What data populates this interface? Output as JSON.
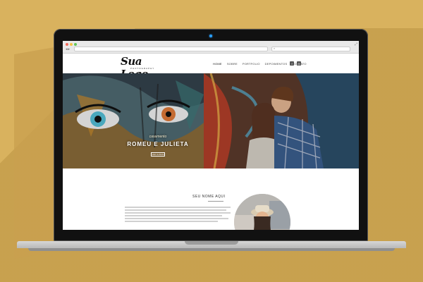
{
  "logo": {
    "main": "Sua Logo",
    "sub": "PHOTOGRAPHY"
  },
  "nav": {
    "items": [
      "HOME",
      "SOBRE",
      "PORTFOLIO",
      "DEPOIMENTOS",
      "CONTATO"
    ]
  },
  "social": {
    "icons": [
      "facebook-icon",
      "instagram-icon"
    ]
  },
  "hero": {
    "kicker": "casamento",
    "title": "ROMEU E JULIETA",
    "button": "VER ALBUM"
  },
  "about": {
    "title": "SEU NOME AQUI"
  },
  "colors": {
    "background": "#d9b25e",
    "laptop_bezel": "#111111",
    "accent_dot": "#2aa0ff"
  }
}
